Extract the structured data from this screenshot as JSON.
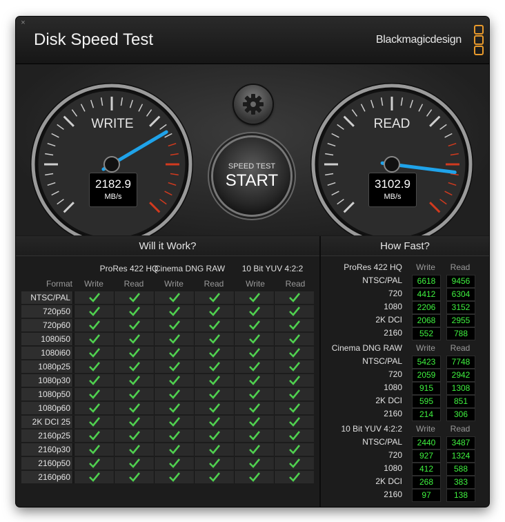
{
  "app": {
    "title": "Disk Speed Test",
    "brand": "Blackmagicdesign",
    "close_glyph": "×"
  },
  "gauges": {
    "write": {
      "label": "WRITE",
      "value": "2182.9",
      "unit": "MB/s",
      "needle_fraction": 0.72
    },
    "read": {
      "label": "READ",
      "value": "3102.9",
      "unit": "MB/s",
      "needle_fraction": 0.86
    }
  },
  "start_button": {
    "small": "SPEED TEST",
    "big": "START"
  },
  "settings": {
    "icon": "gear-icon"
  },
  "will_it_work": {
    "heading": "Will it Work?",
    "groups": [
      "ProRes 422 HQ",
      "Cinema DNG RAW",
      "10 Bit YUV 4:2:2"
    ],
    "format_label": "Format",
    "write_label": "Write",
    "read_label": "Read",
    "formats": [
      "NTSC/PAL",
      "720p50",
      "720p60",
      "1080i50",
      "1080i60",
      "1080p25",
      "1080p30",
      "1080p50",
      "1080p60",
      "2K DCI 25",
      "2160p25",
      "2160p30",
      "2160p50",
      "2160p60"
    ],
    "check_icon": "checkmark-icon",
    "check_color": "#4fd04f"
  },
  "how_fast": {
    "heading": "How Fast?",
    "write_label": "Write",
    "read_label": "Read",
    "sections": [
      {
        "name": "ProRes 422 HQ",
        "rows": [
          {
            "label": "NTSC/PAL",
            "write": "6618",
            "read": "9456"
          },
          {
            "label": "720",
            "write": "4412",
            "read": "6304"
          },
          {
            "label": "1080",
            "write": "2206",
            "read": "3152"
          },
          {
            "label": "2K DCI",
            "write": "2068",
            "read": "2955"
          },
          {
            "label": "2160",
            "write": "552",
            "read": "788"
          }
        ]
      },
      {
        "name": "Cinema DNG RAW",
        "rows": [
          {
            "label": "NTSC/PAL",
            "write": "5423",
            "read": "7748"
          },
          {
            "label": "720",
            "write": "2059",
            "read": "2942"
          },
          {
            "label": "1080",
            "write": "915",
            "read": "1308"
          },
          {
            "label": "2K DCI",
            "write": "595",
            "read": "851"
          },
          {
            "label": "2160",
            "write": "214",
            "read": "306"
          }
        ]
      },
      {
        "name": "10 Bit YUV 4:2:2",
        "rows": [
          {
            "label": "NTSC/PAL",
            "write": "2440",
            "read": "3487"
          },
          {
            "label": "720",
            "write": "927",
            "read": "1324"
          },
          {
            "label": "1080",
            "write": "412",
            "read": "588"
          },
          {
            "label": "2K DCI",
            "write": "268",
            "read": "383"
          },
          {
            "label": "2160",
            "write": "97",
            "read": "138"
          }
        ]
      }
    ],
    "value_color": "#3ff23f"
  }
}
